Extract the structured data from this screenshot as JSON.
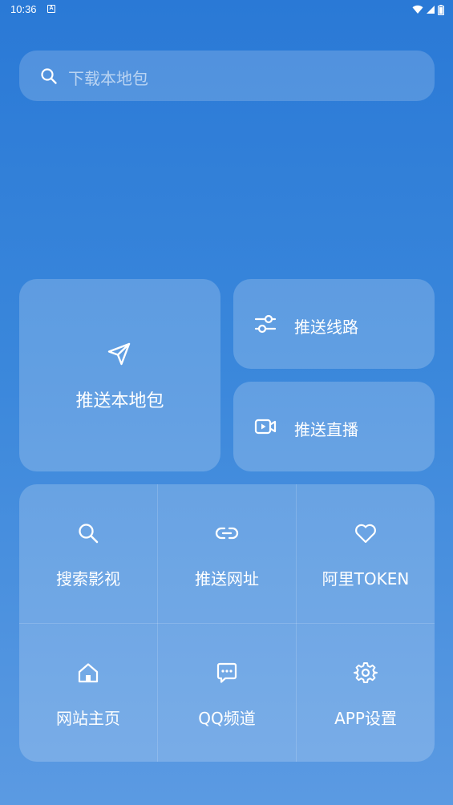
{
  "status_bar": {
    "time": "10:36",
    "notification_glyph": "A",
    "icons": [
      "wifi-icon",
      "signal-icon",
      "battery-icon"
    ]
  },
  "search": {
    "placeholder": "下载本地包",
    "icon": "search-icon"
  },
  "cards": {
    "push_local": {
      "label": "推送本地包",
      "icon": "send-icon"
    },
    "push_route": {
      "label": "推送线路",
      "icon": "sliders-icon"
    },
    "push_live": {
      "label": "推送直播",
      "icon": "video-icon"
    }
  },
  "grid": {
    "items": [
      {
        "label": "搜索影视",
        "icon": "search-icon"
      },
      {
        "label": "推送网址",
        "icon": "link-icon"
      },
      {
        "label": "阿里TOKEN",
        "icon": "heart-icon"
      },
      {
        "label": "网站主页",
        "icon": "home-icon"
      },
      {
        "label": "QQ频道",
        "icon": "chat-icon"
      },
      {
        "label": "APP设置",
        "icon": "gear-icon"
      }
    ]
  },
  "colors": {
    "background_top": "#2a79d6",
    "background_bottom": "#5b9ae2",
    "card_fill": "rgba(255,255,255,0.20)",
    "text": "#ffffff"
  }
}
